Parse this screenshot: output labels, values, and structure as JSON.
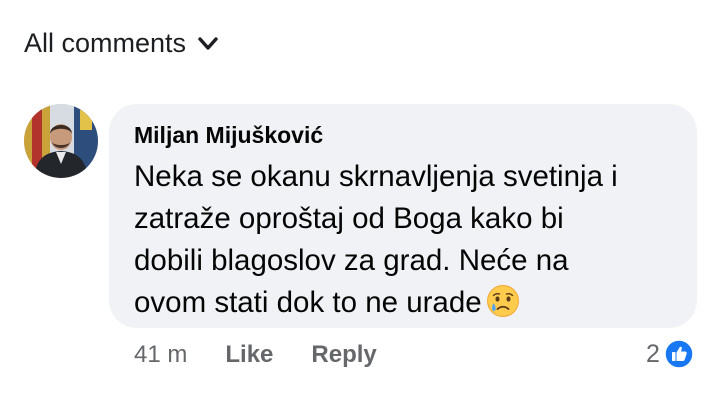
{
  "filter": {
    "label": "All comments",
    "icon": "chevron-down-icon"
  },
  "comment": {
    "author": "Miljan Mijušković",
    "lines": [
      "Neka se okanu skrnavljenja svetinja i",
      "zatraže oproštaj od Boga kako bi",
      "dobili blagoslov za grad. Neće na",
      "ovom stati dok to ne urade"
    ],
    "emoji": "sad-tear-face",
    "time": "41 m",
    "like_label": "Like",
    "reply_label": "Reply",
    "reaction_count": "2",
    "reaction_icon": "like-thumb-icon"
  },
  "colors": {
    "bubble": "#f0f2f5",
    "meta_text": "#65676b",
    "like_blue": "#1877f2"
  }
}
